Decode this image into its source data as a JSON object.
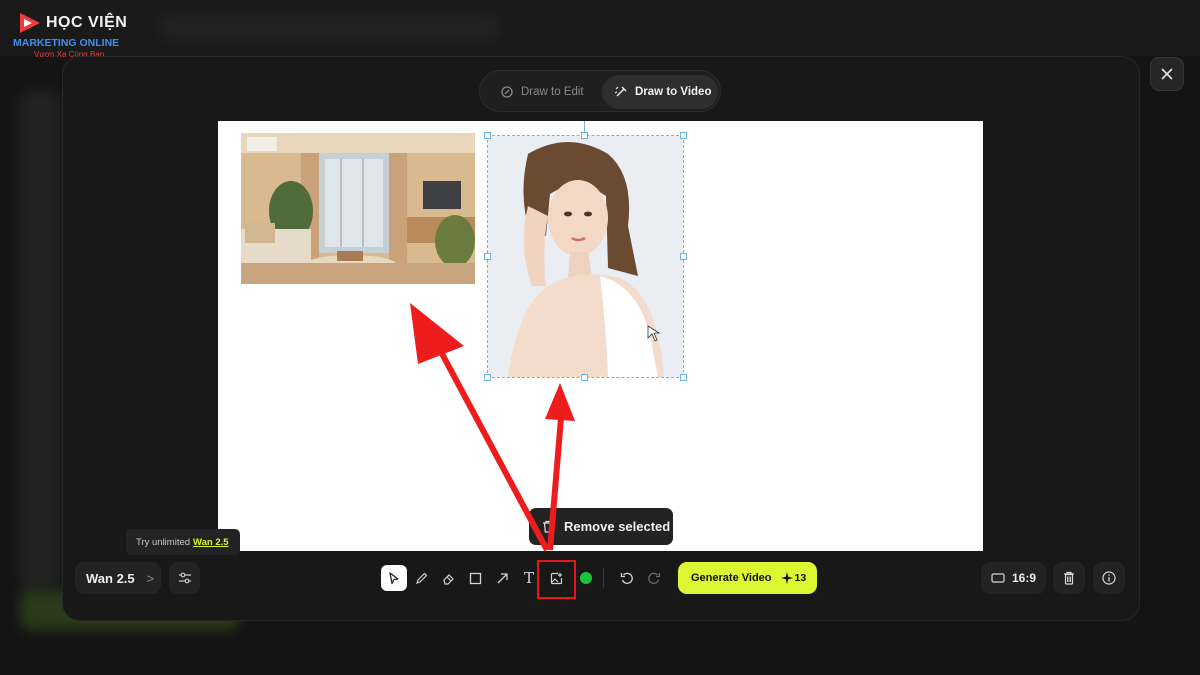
{
  "watermark": {
    "line1": "HỌC VIỆN",
    "line2": "MARKETING ONLINE",
    "line3": "Vươn Xa Cùng Bạn"
  },
  "modal": {
    "modes": [
      {
        "label": "Draw to Edit",
        "active": false,
        "icon": "draw-edit-icon"
      },
      {
        "label": "Draw to Video",
        "active": true,
        "icon": "draw-video-icon"
      }
    ],
    "close_icon": "close-icon"
  },
  "canvas": {
    "images": [
      {
        "name": "living-room-image",
        "selected": false
      },
      {
        "name": "portrait-image",
        "selected": true
      }
    ]
  },
  "toast": {
    "label": "Remove selected",
    "icon": "trash-icon"
  },
  "tooltip": {
    "prefix": "Try unlimited",
    "link": "Wan 2.5",
    "accent": "#d7f53b"
  },
  "toolbar": {
    "model": {
      "label": "Wan 2.5",
      "chevron": ">"
    },
    "settings_icon": "sliders-icon",
    "tools": [
      {
        "name": "select",
        "icon": "cursor-icon",
        "active": true
      },
      {
        "name": "pencil",
        "icon": "pencil-icon",
        "active": false
      },
      {
        "name": "eraser",
        "icon": "eraser-icon",
        "active": false
      },
      {
        "name": "rectangle",
        "icon": "rectangle-icon",
        "active": false
      },
      {
        "name": "arrow",
        "icon": "arrow-icon",
        "active": false
      },
      {
        "name": "text",
        "icon": "text-icon",
        "label": "T",
        "active": false
      },
      {
        "name": "image",
        "icon": "image-upload-icon",
        "active": false
      }
    ],
    "color": "#19c53f",
    "undo_icon": "undo-icon",
    "redo_icon": "redo-icon",
    "generate": {
      "label": "Generate Video",
      "credits": "13",
      "accent": "#dcf731"
    },
    "aspect_ratio": "16:9",
    "delete_icon": "trash-icon",
    "info_icon": "info-icon"
  },
  "annotations": {
    "highlight_color": "#e5171b"
  }
}
